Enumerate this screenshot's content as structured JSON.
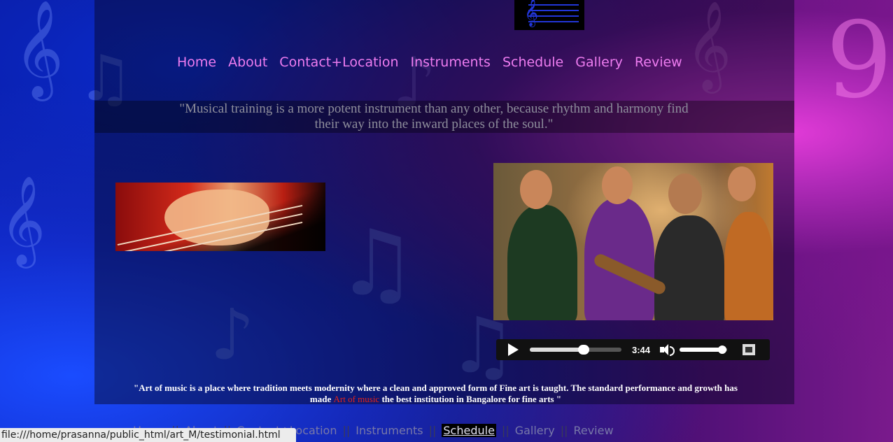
{
  "nav": {
    "items": [
      "Home",
      "About",
      "Contact+Location",
      "Instruments",
      "Schedule",
      "Gallery",
      "Review"
    ]
  },
  "quote": {
    "line1": "\"Musical training is a more potent instrument than any other, because rhythm and harmony find",
    "line2": "their way into the inward places of the soul.\""
  },
  "video": {
    "time": "3:44",
    "progress": 0.59,
    "volume": 0.9
  },
  "statement": {
    "before": "\"Art of music is a place where tradition meets modernity where a clean and approved form of Fine art is taught. The standard performance and growth has made ",
    "highlight": "Art of music",
    "after": " the best institution in Bangalore for fine arts \""
  },
  "footer_nav": {
    "items": [
      "Home",
      "About",
      "Contact+Location",
      "Instruments",
      "Schedule",
      "Gallery",
      "Review"
    ],
    "active": "Schedule"
  },
  "status_bar": {
    "url": "file:///home/prasanna/public_html/art_M/testimonial.html"
  },
  "colors": {
    "nav_text": "#ee7cf0",
    "highlight": "#e2231a",
    "quote_text": "#8e8e9c"
  }
}
